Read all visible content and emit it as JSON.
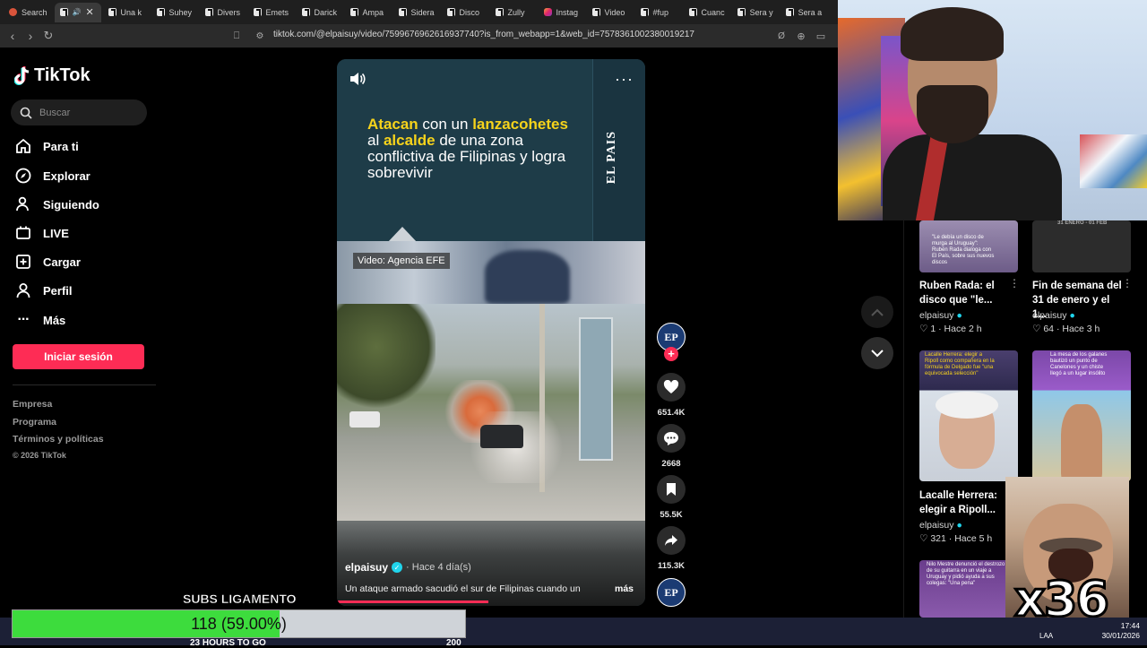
{
  "browser": {
    "tabs": [
      {
        "label": "Search",
        "icon": "google-icon",
        "active": false
      },
      {
        "label": "",
        "icon": "tiktok-icon",
        "active": true
      },
      {
        "label": "Una k",
        "icon": "tiktok-icon"
      },
      {
        "label": "Suhey",
        "icon": "tiktok-icon"
      },
      {
        "label": "Divers",
        "icon": "tiktok-icon"
      },
      {
        "label": "Emets",
        "icon": "tiktok-icon"
      },
      {
        "label": "Darick",
        "icon": "tiktok-icon"
      },
      {
        "label": "Ampa",
        "icon": "tiktok-icon"
      },
      {
        "label": "Sidera",
        "icon": "tiktok-icon"
      },
      {
        "label": "Disco",
        "icon": "tiktok-icon"
      },
      {
        "label": "Zully",
        "icon": "tiktok-icon"
      },
      {
        "label": "Instag",
        "icon": "instagram-icon"
      },
      {
        "label": "Video",
        "icon": "tiktok-icon"
      },
      {
        "label": "#fup",
        "icon": "tiktok-icon"
      },
      {
        "label": "Cuanc",
        "icon": "tiktok-icon"
      },
      {
        "label": "Sera y",
        "icon": "tiktok-icon"
      },
      {
        "label": "Sera a",
        "icon": "tiktok-icon"
      }
    ],
    "url": "tiktok.com/@elpaisuy/video/7599676962616937740?is_from_webapp=1&web_id=7578361002380019217"
  },
  "tiktok": {
    "logo": "TikTok",
    "search_placeholder": "Buscar",
    "nav": [
      {
        "label": "Para ti",
        "icon": "home-icon"
      },
      {
        "label": "Explorar",
        "icon": "compass-icon"
      },
      {
        "label": "Siguiendo",
        "icon": "users-icon"
      },
      {
        "label": "LIVE",
        "icon": "live-icon"
      },
      {
        "label": "Cargar",
        "icon": "upload-icon"
      },
      {
        "label": "Perfil",
        "icon": "profile-icon"
      },
      {
        "label": "Más",
        "icon": "more-icon"
      }
    ],
    "login_label": "Iniciar sesión",
    "footer": [
      "Empresa",
      "Programa",
      "Términos y políticas"
    ],
    "copyright": "© 2026 TikTok"
  },
  "video": {
    "headline_parts": [
      {
        "text": "Atacan",
        "highlight": true
      },
      {
        "text": " con un ",
        "highlight": false
      },
      {
        "text": "lanzacohetes",
        "highlight": true
      },
      {
        "text": " al ",
        "highlight": false
      },
      {
        "text": "alcalde",
        "highlight": true
      },
      {
        "text": " de una zona conflictiva de Filipinas y logra sobrevivir",
        "highlight": false
      }
    ],
    "brand_vertical": "EL PAIS",
    "credit": "Video: Agencia EFE",
    "author": "elpaisuy",
    "ago": "· Hace 4 día(s)",
    "caption": "Un ataque armado sacudió el sur de Filipinas cuando un",
    "more": "más",
    "progress": 0.49
  },
  "actions": {
    "avatar": "EP",
    "likes": "651.4K",
    "comments": "2668",
    "saves": "55.5K",
    "shares": "115.3K"
  },
  "sidebar_videos": [
    {
      "title": "Ruben Rada: el disco que \"le...",
      "author": "elpaisuy",
      "likes": "1",
      "ago": "Hace 2 h",
      "thumb_text": "\"Le debía un disco de murga al Uruguay\": Rubén Rada dialoga con El País, sobre sus nuevos discos"
    },
    {
      "title": "Fin de semana del 31 de enero y el 1...",
      "author": "elpaisuy",
      "likes": "64",
      "ago": "Hace 3 h",
      "thumb_text": "31 ENERO - 01 FEB"
    },
    {
      "title": "Lacalle Herrera: elegir a Ripoll...",
      "author": "elpaisuy",
      "likes": "321",
      "ago": "Hace 5 h",
      "thumb_text": "Lacalle Herrera: elegir a Ripoll como compañera en la fórmula de Delgado fue \"una equivocada selección\""
    },
    {
      "title": "",
      "author": "",
      "likes": "",
      "ago": "",
      "thumb_text": "La mesa de los galanes bautizó un punto de Canelones y un chiste llegó a un lugar insólito"
    },
    {
      "title": "",
      "author": "",
      "likes": "",
      "ago": "",
      "thumb_text": "Nilo Mestre denunció el destrozo de su guitarra en un viaje a Uruguay y pidió ayuda a sus colegas: \"Una pena\""
    }
  ],
  "overlay": {
    "subs_title": "SUBS LIGAMENTO",
    "subs_value": "118 (59.00%)",
    "subs_fraction": 0.59,
    "meme_text": "x36",
    "hours_text": "23 HOURS TO GO",
    "counter": "200"
  },
  "taskbar": {
    "lang": "LAA",
    "time": "17:44",
    "date": "30/01/2026"
  },
  "colors": {
    "tiktok_red": "#fe2c55",
    "headline_yellow": "#f7d31b",
    "verified": "#20d5ec",
    "subs_green": "#3ddc3d"
  }
}
